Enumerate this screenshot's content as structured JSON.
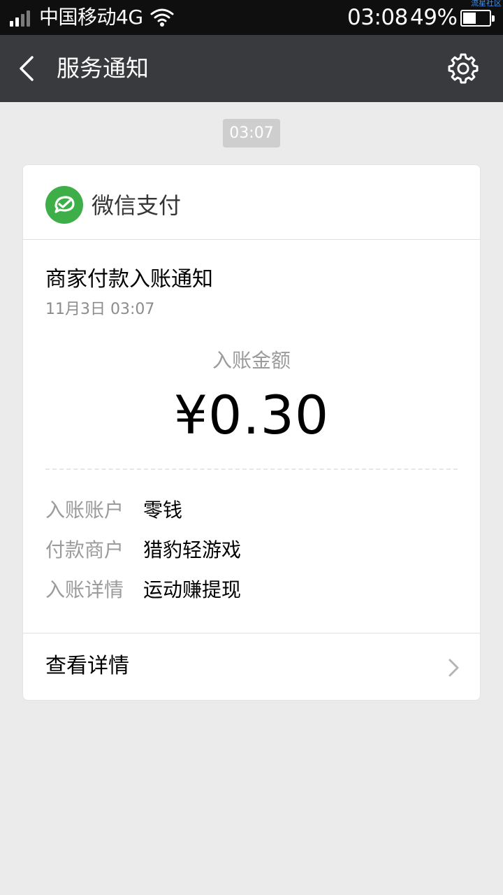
{
  "status_bar": {
    "carrier": "中国移动4G",
    "time": "03:08",
    "battery_percent": "49%",
    "battery_level": 0.49,
    "watermark": "流星社区",
    "icons": [
      "signal-icon",
      "wifi-icon",
      "battery-icon"
    ]
  },
  "nav": {
    "title": "服务通知",
    "back_icon": "chevron-left-icon",
    "settings_icon": "gear-icon"
  },
  "message": {
    "time": "03:07"
  },
  "card": {
    "sender": "微信支付",
    "sender_icon": "wechat-pay-icon",
    "title": "商家付款入账通知",
    "date": "11月3日  03:07",
    "amount_label": "入账金额",
    "amount": "¥0.30",
    "details": [
      {
        "label": "入账账户",
        "value": "零钱"
      },
      {
        "label": "付款商户",
        "value": "猎豹轻游戏"
      },
      {
        "label": "入账详情",
        "value": "运动赚提现"
      }
    ],
    "footer_label": "查看详情",
    "footer_icon": "chevron-right-icon"
  },
  "colors": {
    "status_bar_bg": "#0f0f0f",
    "nav_bg": "#393a3e",
    "page_bg": "#ebebeb",
    "pay_green": "#3dae48"
  }
}
